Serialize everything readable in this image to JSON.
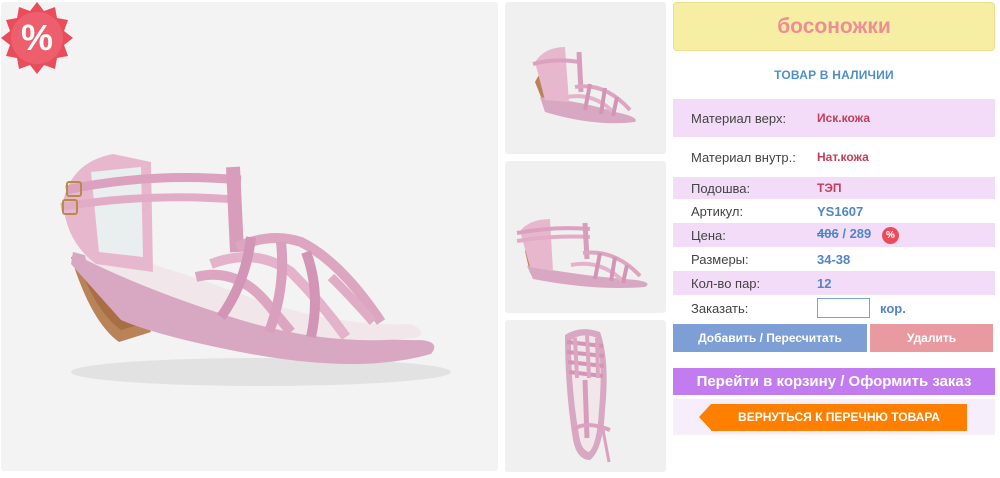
{
  "product": {
    "title": "босоножки",
    "stock_status": "ТОВАР В НАЛИЧИИ"
  },
  "sale_badge": {
    "symbol": "%",
    "color": "#e94d5c"
  },
  "specs": {
    "material_top": {
      "label": "Материал верх:",
      "value": "Иск.кожа"
    },
    "material_inner": {
      "label": "Материал внутр.:",
      "value": "Нат.кожа"
    },
    "sole": {
      "label": "Подошва:",
      "value": "ТЭП"
    },
    "article": {
      "label": "Артикул:",
      "value": "YS1607"
    },
    "price": {
      "label": "Цена:",
      "old": "406",
      "separator": "/",
      "new": "289",
      "badge": "%"
    },
    "sizes": {
      "label": "Размеры:",
      "value": "34-38"
    },
    "pairs": {
      "label": "Кол-во пар:",
      "value": "12"
    },
    "order": {
      "label": "Заказать:",
      "input_value": "",
      "unit": "кор."
    }
  },
  "buttons": {
    "add": "Добавить / Пересчитать",
    "delete": "Удалить",
    "cart": "Перейти в корзину / Оформить заказ",
    "back": "ВЕРНУТЬСЯ К ПЕРЕЧНЮ ТОВАРА"
  },
  "colors": {
    "title_bg": "#f6eea3",
    "title_text": "#f08c95",
    "row_pink": "#f3dcf7",
    "add_button": "#7d9fd6",
    "delete_button": "#e99aa1",
    "cart_button": "#c27cf0",
    "back_button": "#ff7f00"
  }
}
